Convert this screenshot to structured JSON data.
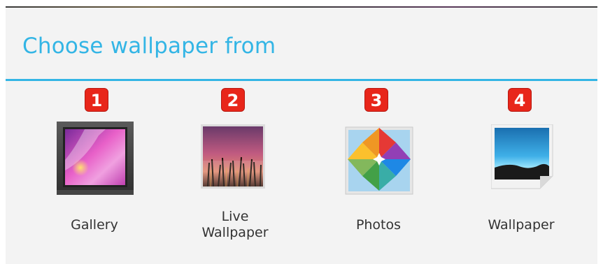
{
  "dialog": {
    "title": "Choose wallpaper from"
  },
  "options": [
    {
      "number": "1",
      "label": "Gallery",
      "icon": "gallery-icon"
    },
    {
      "number": "2",
      "label": "Live\nWallpaper",
      "icon": "live-wallpaper-icon"
    },
    {
      "number": "3",
      "label": "Photos",
      "icon": "photos-icon"
    },
    {
      "number": "4",
      "label": "Wallpaper",
      "icon": "wallpaper-icon"
    }
  ],
  "colors": {
    "accent": "#33b5e5",
    "badge": "#e8261a",
    "background": "#f3f3f3"
  }
}
